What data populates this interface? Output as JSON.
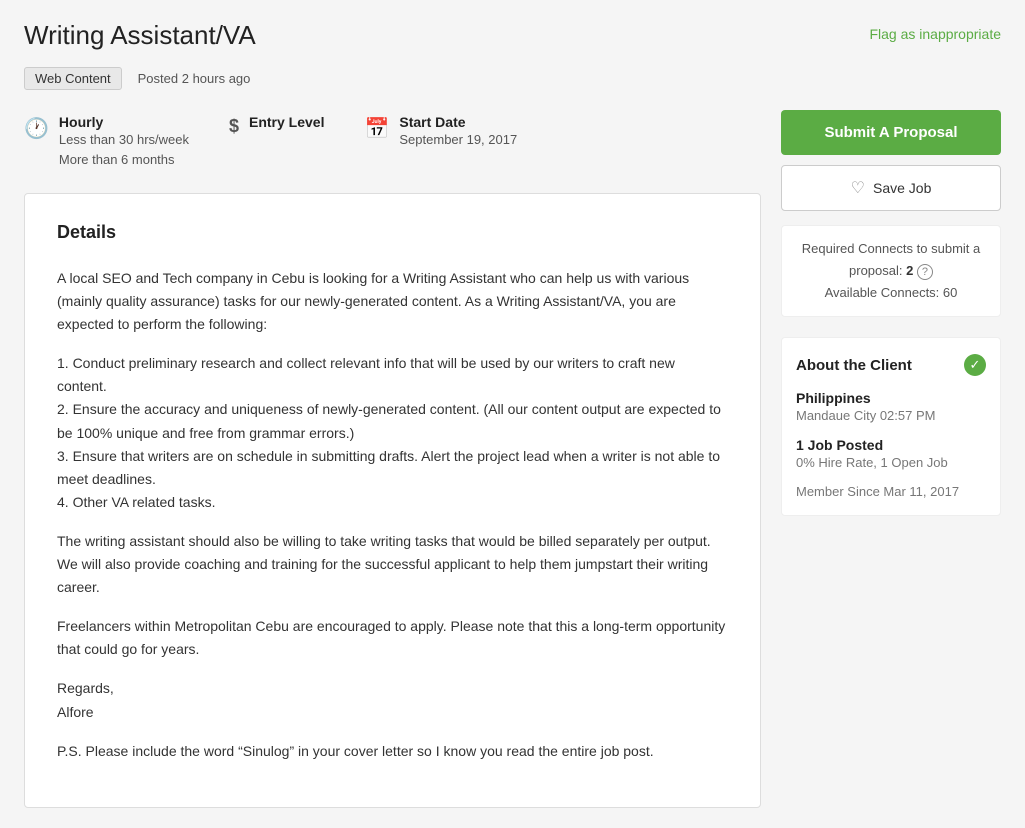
{
  "header": {
    "title": "Writing Assistant/VA",
    "flag_label": "Flag as inappropriate"
  },
  "meta": {
    "tag": "Web Content",
    "posted": "Posted 2 hours ago"
  },
  "job_info": {
    "type_label": "Hourly",
    "type_sub1": "Less than 30 hrs/week",
    "type_sub2": "More than 6 months",
    "level_label": "Entry Level",
    "startdate_label": "Start Date",
    "startdate_value": "September 19, 2017"
  },
  "details": {
    "section_title": "Details",
    "paragraphs": [
      "A local SEO and Tech company in Cebu is looking for a Writing Assistant who can help us with various (mainly quality assurance) tasks for our newly-generated content. As a Writing Assistant/VA, you are expected to perform the following:",
      "1. Conduct preliminary research and collect relevant info that will be used by our writers to craft new content.\n2. Ensure the accuracy and uniqueness of newly-generated content. (All our content output are expected to be 100% unique and free from grammar errors.)\n3. Ensure that writers are on schedule in submitting drafts. Alert the project lead when a writer is not able to meet deadlines.\n4. Other VA related tasks.",
      "The writing assistant should also be willing to take writing tasks that would be billed separately per output. We will also provide coaching and training for the successful applicant to help them jumpstart their writing career.",
      "Freelancers within Metropolitan Cebu are encouraged to apply. Please note that this a long-term opportunity that could go for years.",
      "Regards,\nAlfore",
      "P.S. Please include the word “Sinulog” in your cover letter so I know you read the entire job post."
    ]
  },
  "sidebar": {
    "submit_btn": "Submit A Proposal",
    "save_btn": "Save Job",
    "connects_text": "Required Connects to submit a proposal:",
    "connects_number": "2",
    "available_connects": "Available Connects: 60",
    "client_title": "About the Client",
    "client_country": "Philippines",
    "client_city": "Mandaue City 02:57 PM",
    "client_jobs_label": "1 Job Posted",
    "client_hire_rate": "0% Hire Rate, 1 Open Job",
    "client_member": "Member Since Mar 11, 2017"
  }
}
